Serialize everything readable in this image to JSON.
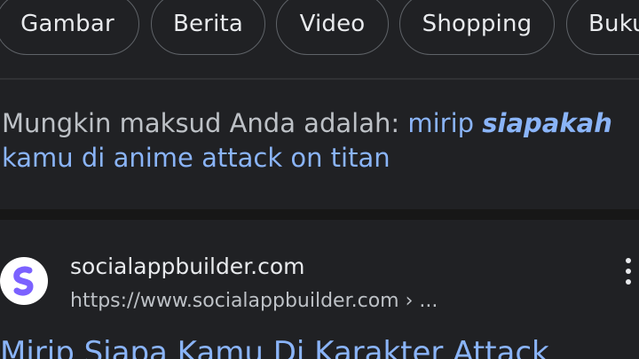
{
  "chips": [
    {
      "label": "Gambar"
    },
    {
      "label": "Berita"
    },
    {
      "label": "Video"
    },
    {
      "label": "Shopping"
    },
    {
      "label": "Buku"
    }
  ],
  "did_you_mean": {
    "prefix": "Mungkin maksud Anda adalah: ",
    "link_start": "mirip ",
    "link_emphasis": "siapakah",
    "link_end": "kamu di anime attack on titan"
  },
  "result": {
    "favicon": "socialappbuilder-s-logo-icon",
    "site_name": "socialappbuilder.com",
    "url": "https://www.socialappbuilder.com › ...",
    "title": "Mirip Siapa Kamu Di Karakter Attack"
  },
  "colors": {
    "background": "#202124",
    "link": "#8ab4f8",
    "text": "#e8eaed",
    "muted_text": "#bdc1c6",
    "favicon_accent": "#7b61ff"
  }
}
